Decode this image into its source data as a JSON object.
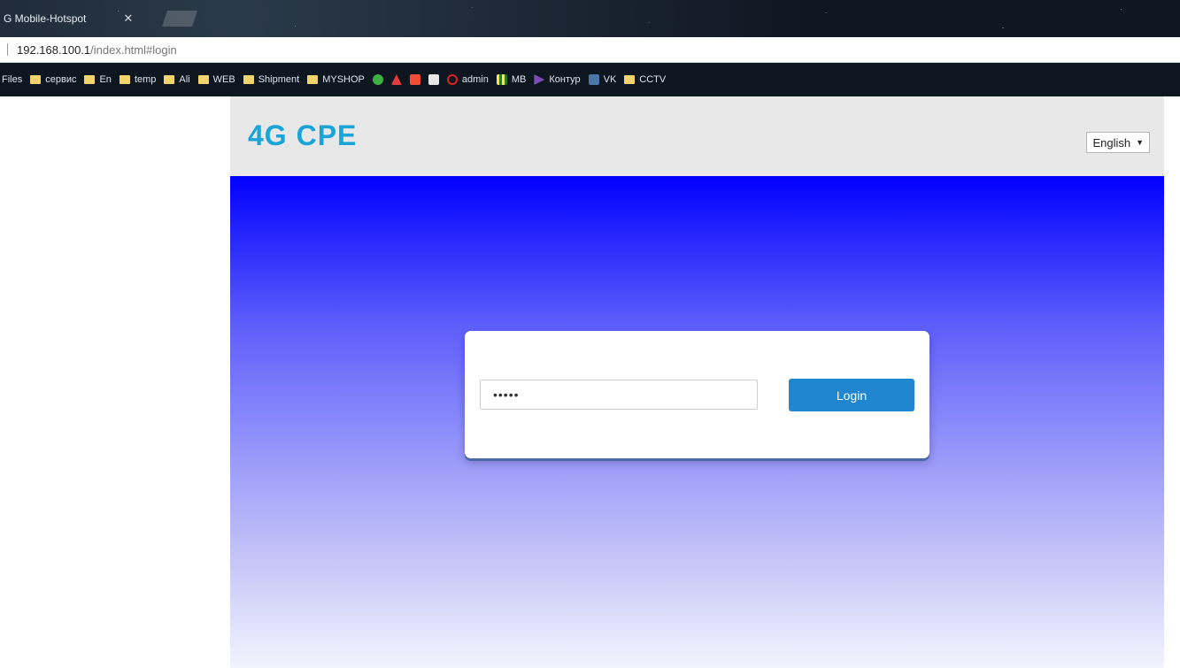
{
  "browser": {
    "tab_title": "G Mobile-Hotspot",
    "tab_close": "✕",
    "url_host": "192.168.100.1",
    "url_path": "/index.html#login",
    "bookmarks": [
      {
        "label": "Files",
        "icon": "none"
      },
      {
        "label": "сервис",
        "icon": "folder"
      },
      {
        "label": "En",
        "icon": "folder"
      },
      {
        "label": "temp",
        "icon": "folder"
      },
      {
        "label": "Ali",
        "icon": "folder"
      },
      {
        "label": "WEB",
        "icon": "folder"
      },
      {
        "label": "Shipment",
        "icon": "folder"
      },
      {
        "label": "MYSHOP",
        "icon": "folder"
      },
      {
        "label": "",
        "icon": "green-circle"
      },
      {
        "label": "",
        "icon": "red-triangle"
      },
      {
        "label": "",
        "icon": "red-square"
      },
      {
        "label": "",
        "icon": "white-square"
      },
      {
        "label": "admin",
        "icon": "red-ring"
      },
      {
        "label": "MB",
        "icon": "yellow-grid"
      },
      {
        "label": "Контур",
        "icon": "purple-mark"
      },
      {
        "label": "VK",
        "icon": "vk"
      },
      {
        "label": "CCTV",
        "icon": "folder"
      }
    ]
  },
  "header": {
    "logo": "4G CPE",
    "language": "English",
    "language_arrow": "▼"
  },
  "login": {
    "password_value": "•••••",
    "button_label": "Login"
  },
  "colors": {
    "logo": "#1aa5d8",
    "button": "#1f86cf",
    "hero_top": "#0000ff",
    "header_bg": "#e8e8e8"
  }
}
